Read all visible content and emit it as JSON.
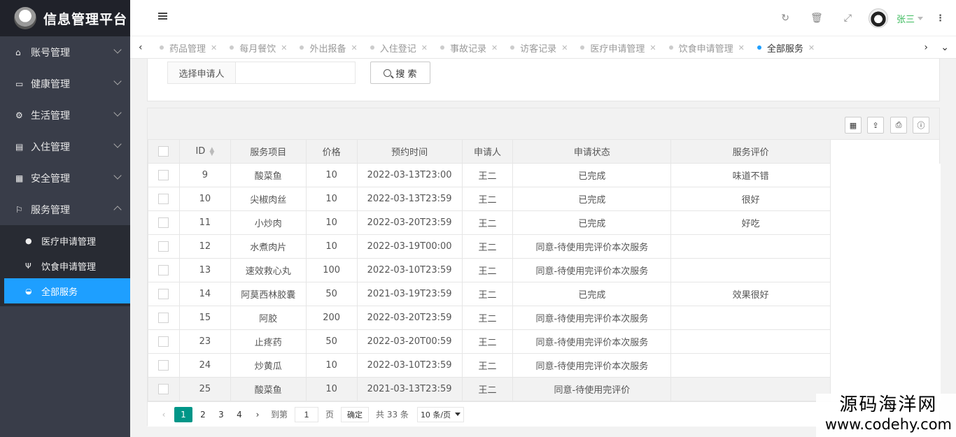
{
  "app": {
    "title": "信息管理平台"
  },
  "sidebar": {
    "items": [
      {
        "label": "账号管理",
        "icon": "home-icon"
      },
      {
        "label": "健康管理",
        "icon": "window-icon"
      },
      {
        "label": "生活管理",
        "icon": "cogs-icon"
      },
      {
        "label": "入住管理",
        "icon": "file-icon"
      },
      {
        "label": "安全管理",
        "icon": "calendar-icon"
      },
      {
        "label": "服务管理",
        "icon": "flag-icon"
      }
    ],
    "sub_items": [
      {
        "label": "医疗申请管理",
        "icon": "medical-icon"
      },
      {
        "label": "饮食申请管理",
        "icon": "food-icon"
      },
      {
        "label": "全部服务",
        "icon": "dashboard-icon",
        "active": true
      }
    ]
  },
  "header": {
    "username": "张三"
  },
  "tabs": [
    {
      "label": "药品管理"
    },
    {
      "label": "每月餐饮"
    },
    {
      "label": "外出报备"
    },
    {
      "label": "入住登记"
    },
    {
      "label": "事故记录"
    },
    {
      "label": "访客记录"
    },
    {
      "label": "医疗申请管理"
    },
    {
      "label": "饮食申请管理"
    },
    {
      "label": "全部服务",
      "active": true
    }
  ],
  "search": {
    "label": "选择申请人",
    "input_value": "",
    "button": "搜 索"
  },
  "table": {
    "columns": [
      "ID",
      "服务项目",
      "价格",
      "预约时间",
      "申请人",
      "申请状态",
      "服务评价"
    ],
    "rows": [
      [
        "9",
        "酸菜鱼",
        "10",
        "2022-03-13T23:00",
        "王二",
        "已完成",
        "味道不错"
      ],
      [
        "10",
        "尖椒肉丝",
        "10",
        "2022-03-13T23:59",
        "王二",
        "已完成",
        "很好"
      ],
      [
        "11",
        "小炒肉",
        "10",
        "2022-03-20T23:59",
        "王二",
        "已完成",
        "好吃"
      ],
      [
        "12",
        "水煮肉片",
        "10",
        "2022-03-19T00:00",
        "王二",
        "同意-待使用完评价本次服务",
        ""
      ],
      [
        "13",
        "速效救心丸",
        "100",
        "2022-03-10T23:59",
        "王二",
        "同意-待使用完评价本次服务",
        ""
      ],
      [
        "14",
        "阿莫西林胶囊",
        "50",
        "2021-03-19T23:59",
        "王二",
        "已完成",
        "效果很好"
      ],
      [
        "15",
        "阿胶",
        "200",
        "2022-03-20T23:59",
        "王二",
        "同意-待使用完评价本次服务",
        ""
      ],
      [
        "23",
        "止疼药",
        "50",
        "2022-03-20T00:59",
        "王二",
        "同意-待使用完评价本次服务",
        ""
      ],
      [
        "24",
        "炒黄瓜",
        "10",
        "2022-03-10T23:59",
        "王二",
        "同意-待使用完评价本次服务",
        ""
      ],
      [
        "25",
        "酸菜鱼",
        "10",
        "2021-03-13T23:59",
        "王二",
        "同意-待使用完评价",
        ""
      ]
    ]
  },
  "pager": {
    "pages": [
      "1",
      "2",
      "3",
      "4"
    ],
    "current": "1",
    "goto_label": "到第",
    "goto_value": "1",
    "page_unit": "页",
    "confirm": "确定",
    "total": "共 33 条",
    "page_size": "10 条/页"
  },
  "watermark": {
    "line1": "源码海洋网",
    "line2": "www.codehy.com"
  }
}
